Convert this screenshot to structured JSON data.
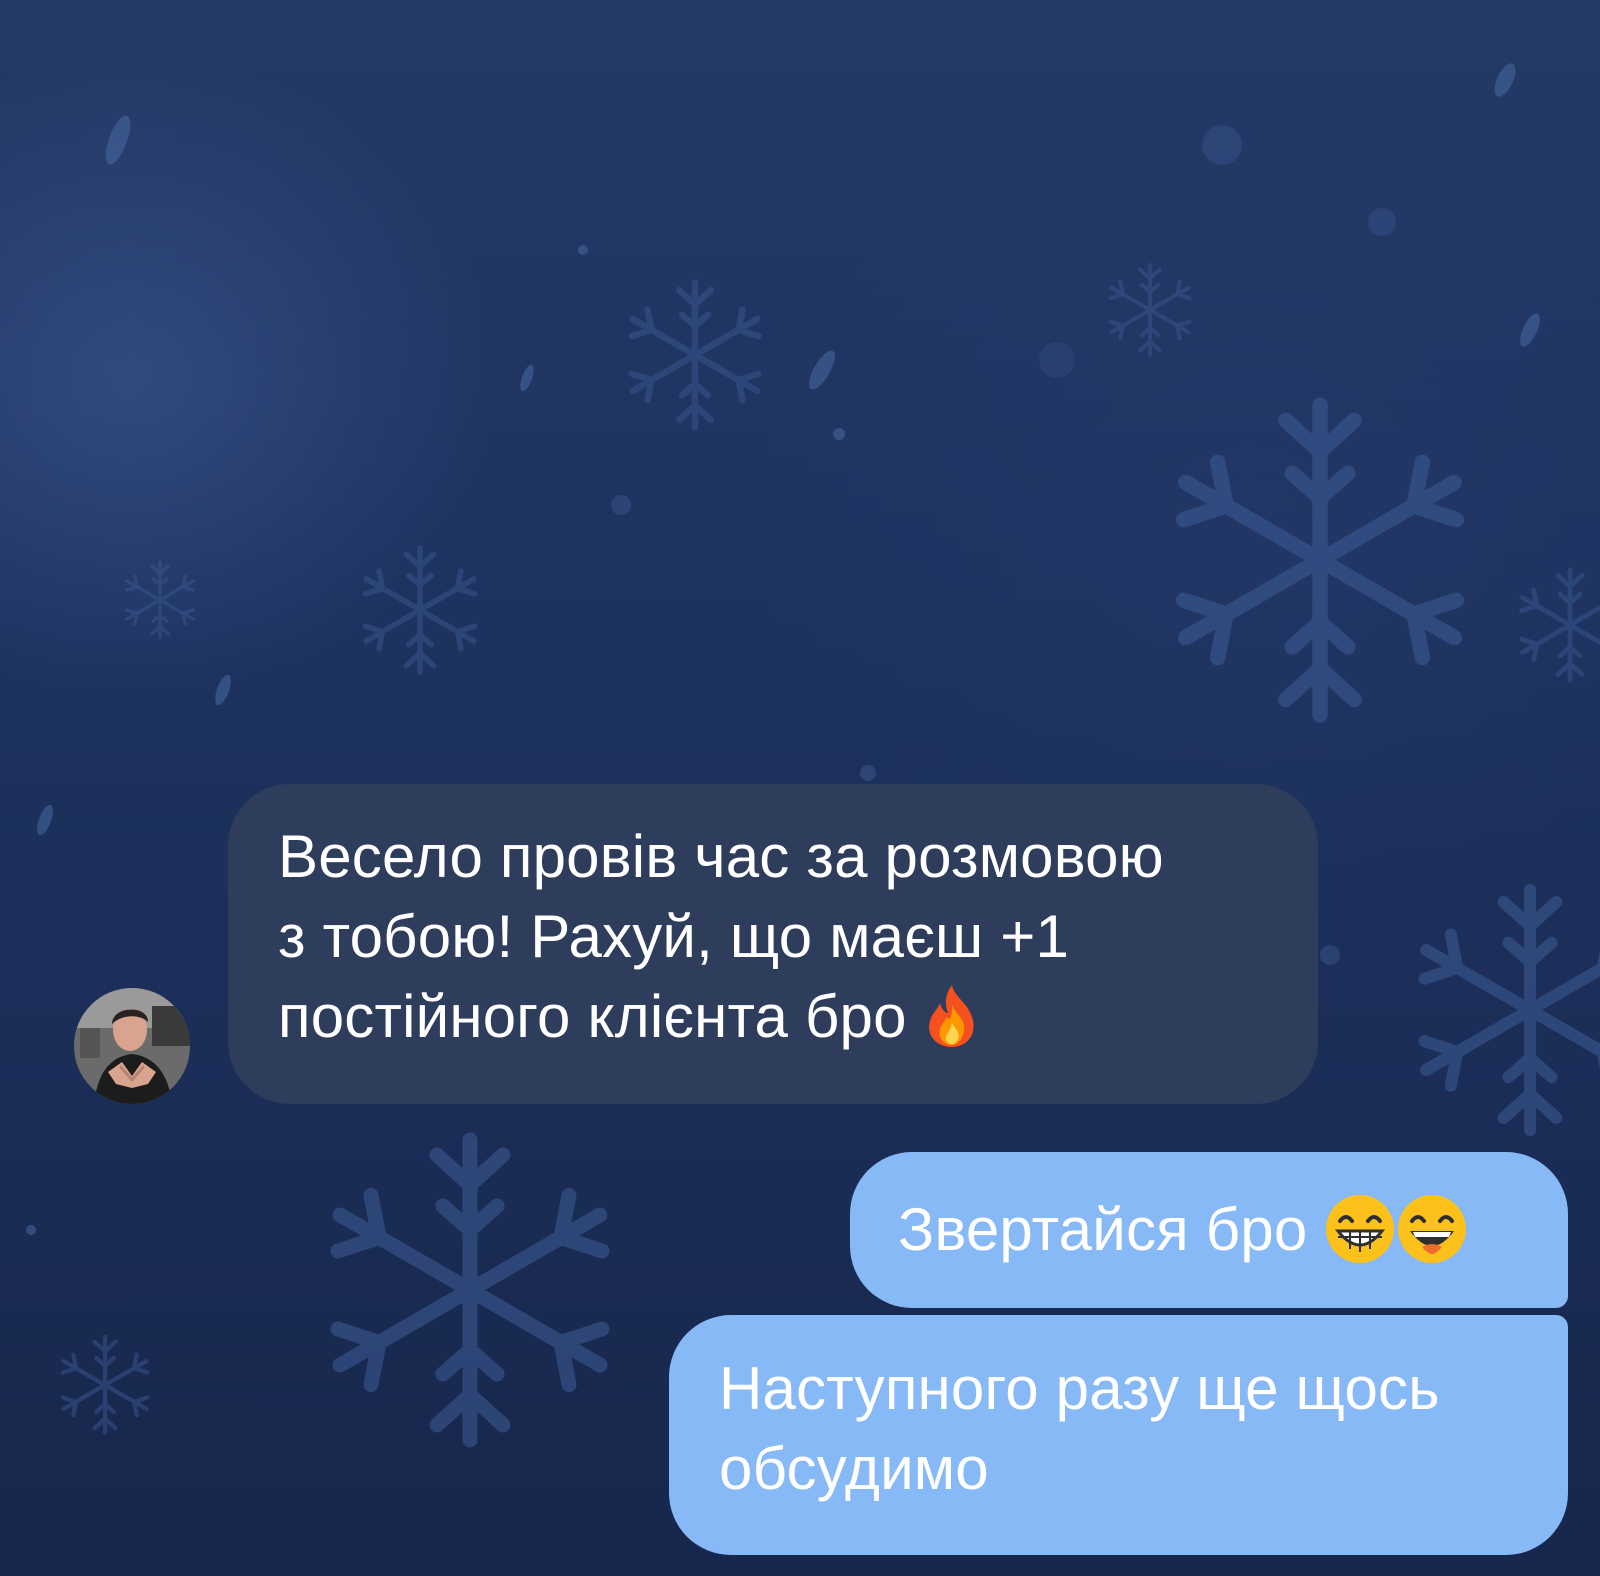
{
  "chat": {
    "messages": [
      {
        "direction": "incoming",
        "lines": [
          "Весело провів час за розмовою",
          "з тобою! Рахуй, що маєш +1",
          "постійного клієнта бро"
        ],
        "emoji": [
          "fire-emoji"
        ]
      },
      {
        "direction": "outgoing",
        "text": "Звертайся бро",
        "emoji": [
          "grinning-face-emoji",
          "laughing-face-emoji"
        ]
      },
      {
        "direction": "outgoing",
        "lines": [
          "Наступного разу ще щось",
          "обсудимо"
        ]
      }
    ]
  },
  "colors": {
    "incoming_bubble": "#2e3d5b",
    "outgoing_bubble": "#87b9f7",
    "text": "#ffffff",
    "background": "#1e3360"
  }
}
